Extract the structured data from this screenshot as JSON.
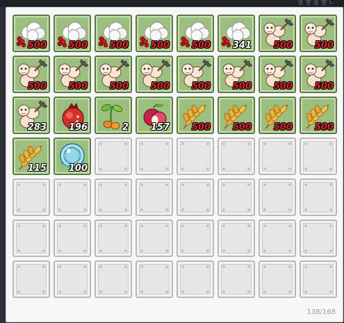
{
  "window": {
    "title_fragment": "열 쌓 열 쌓 ㄴ"
  },
  "inventory": {
    "capacity_used": "138",
    "capacity_total": "168",
    "capacity_text": "138/168",
    "slots": [
      {
        "icon": "cotton-berry-icon",
        "qty": "500",
        "max": true
      },
      {
        "icon": "cotton-berry-icon",
        "qty": "500",
        "max": true
      },
      {
        "icon": "cotton-berry-icon",
        "qty": "500",
        "max": true
      },
      {
        "icon": "cotton-berry-icon",
        "qty": "500",
        "max": true
      },
      {
        "icon": "cotton-berry-icon",
        "qty": "500",
        "max": true
      },
      {
        "icon": "cotton-berry-icon",
        "qty": "341",
        "max": false
      },
      {
        "icon": "grub-icon",
        "qty": "500",
        "max": true
      },
      {
        "icon": "grub-icon",
        "qty": "500",
        "max": true
      },
      {
        "icon": "grub-icon",
        "qty": "500",
        "max": true
      },
      {
        "icon": "grub-icon",
        "qty": "500",
        "max": true
      },
      {
        "icon": "grub-icon",
        "qty": "500",
        "max": true
      },
      {
        "icon": "grub-icon",
        "qty": "500",
        "max": true
      },
      {
        "icon": "grub-icon",
        "qty": "500",
        "max": true
      },
      {
        "icon": "grub-icon",
        "qty": "500",
        "max": true
      },
      {
        "icon": "grub-icon",
        "qty": "500",
        "max": true
      },
      {
        "icon": "grub-icon",
        "qty": "500",
        "max": true
      },
      {
        "icon": "grub-icon",
        "qty": "283",
        "max": false
      },
      {
        "icon": "pomegranate-icon",
        "qty": "196",
        "max": false
      },
      {
        "icon": "sprout-icon",
        "qty": "2",
        "max": false
      },
      {
        "icon": "plum-icon",
        "qty": "157",
        "max": false
      },
      {
        "icon": "wheat-icon",
        "qty": "500",
        "max": true
      },
      {
        "icon": "wheat-icon",
        "qty": "500",
        "max": true
      },
      {
        "icon": "wheat-icon",
        "qty": "500",
        "max": true
      },
      {
        "icon": "wheat-icon",
        "qty": "500",
        "max": true
      },
      {
        "icon": "wheat-icon",
        "qty": "115",
        "max": false
      },
      {
        "icon": "crystal-orb-icon",
        "qty": "100",
        "max": false
      }
    ],
    "empty_slot_count": 30
  },
  "colors": {
    "slot_filled_bg": "#9cbf7f",
    "slot_filled_border": "#5a7842",
    "slot_empty_bg": "#e6e6e6",
    "qty_max": "#e0262a",
    "qty_normal": "#ffffff"
  }
}
